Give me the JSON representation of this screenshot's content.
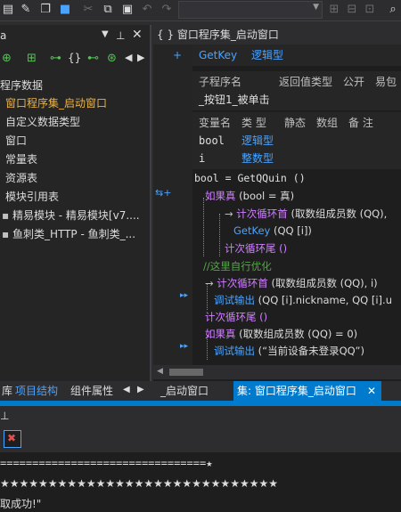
{
  "toolbar": {
    "icons": [
      "open-icon",
      "new-icon",
      "copy-icon",
      "save-icon",
      "cut-icon",
      "copy2-icon",
      "paste-icon",
      "undo-icon",
      "redo-icon"
    ]
  },
  "left_panel": {
    "pin": "▾ ⊓ ✕",
    "tree": [
      {
        "label": "程序数据",
        "indent": 0,
        "color": "#dcdcdc"
      },
      {
        "label": "窗口程序集_启动窗口",
        "indent": 2,
        "color": "#e8b24a"
      },
      {
        "label": "自定义数据类型",
        "indent": 1,
        "color": "#dcdcdc"
      },
      {
        "label": "窗口",
        "indent": 1,
        "color": "#dcdcdc"
      },
      {
        "label": "常量表",
        "indent": 1,
        "color": "#dcdcdc"
      },
      {
        "label": "资源表",
        "indent": 1,
        "color": "#dcdcdc"
      },
      {
        "label": "模块引用表",
        "indent": 1,
        "color": "#dcdcdc"
      },
      {
        "label": "精易模块 - 精易模块[v7....",
        "indent": 2,
        "color": "#dcdcdc"
      },
      {
        "label": "鱼刺类_HTTP - 鱼刺类_...",
        "indent": 2,
        "color": "#dcdcdc"
      }
    ]
  },
  "editor": {
    "title": "窗口程序集_启动窗口",
    "table1": {
      "c1": "GetKey",
      "c2": "逻辑型"
    },
    "table2": {
      "headers": [
        "子程序名",
        "返回值类型",
        "公开",
        "易包"
      ],
      "row": "_按钮1_被单击"
    },
    "table3": {
      "headers": [
        "变量名",
        "类 型",
        "静态",
        "数组",
        "备 注"
      ],
      "rows": [
        [
          "bool",
          "逻辑型"
        ],
        [
          "i",
          "整数型"
        ]
      ]
    },
    "code": {
      "l1": "bool = GetQQuin ()",
      "l2a": "如果真",
      "l2b": " (bool = 真)",
      "l3a": "计次循环首",
      "l3b": " (取数组成员数 (QQ),",
      "l4a": "GetKey",
      "l4b": " (QQ [i])",
      "l5": "计次循环尾 ()",
      "l6": "//这里自行优化",
      "l7a": "计次循环首",
      "l7b": " (取数组成员数 (QQ), i)",
      "l8a": "调试输出",
      "l8b": " (QQ [i].nickname, QQ [i].u",
      "l9": "计次循环尾 ()",
      "l10a": "如果真",
      "l10b": " (取数组成员数 (QQ) = 0)",
      "l11a": "调试输出",
      "l11b": " (“当前设备未登录QQ”)"
    }
  },
  "bottom_tabs": {
    "t0": "库",
    "t1": "项目结构",
    "t2": "组件属性",
    "t3": "_启动窗口",
    "t4": "集: 窗口程序集_启动窗口"
  },
  "output": {
    "line1": "================================★",
    "line2": "★★★★★★★★★★★★★★★★★★★★★★★★★★★★★",
    "line3": "取成功!\""
  },
  "colors": {
    "accent": "#007acc",
    "keyword": "#d080ff",
    "function": "#4aa3ff",
    "comment": "#57a64a"
  }
}
